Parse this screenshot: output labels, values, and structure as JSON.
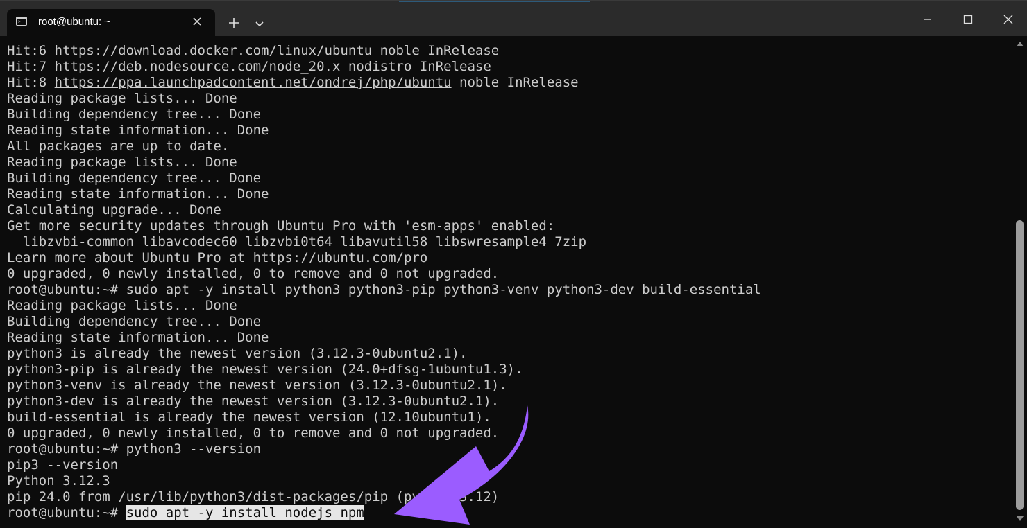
{
  "window": {
    "tab_title": "root@ubuntu: ~",
    "tab_icon": "terminal-icon",
    "controls": [
      "close-icon",
      "plus-icon",
      "chevron-down-icon",
      "minimize-icon",
      "maximize-icon",
      "close-icon"
    ]
  },
  "terminal": {
    "lines": [
      "Hit:6 https://download.docker.com/linux/ubuntu noble InRelease",
      "Hit:7 https://deb.nodesource.com/node_20.x nodistro InRelease",
      "Reading package lists... Done",
      "Building dependency tree... Done",
      "Reading state information... Done",
      "All packages are up to date.",
      "Reading package lists... Done",
      "Building dependency tree... Done",
      "Reading state information... Done",
      "Calculating upgrade... Done",
      "Get more security updates through Ubuntu Pro with 'esm-apps' enabled:",
      "  libzvbi-common libavcodec60 libzvbi0t64 libavutil58 libswresample4 7zip",
      "Learn more about Ubuntu Pro at https://ubuntu.com/pro",
      "0 upgraded, 0 newly installed, 0 to remove and 0 not upgraded.",
      "root@ubuntu:~# sudo apt -y install python3 python3-pip python3-venv python3-dev build-essential",
      "Reading package lists... Done",
      "Building dependency tree... Done",
      "Reading state information... Done",
      "python3 is already the newest version (3.12.3-0ubuntu2.1).",
      "python3-pip is already the newest version (24.0+dfsg-1ubuntu1.3).",
      "python3-venv is already the newest version (3.12.3-0ubuntu2.1).",
      "python3-dev is already the newest version (3.12.3-0ubuntu2.1).",
      "build-essential is already the newest version (12.10ubuntu1).",
      "0 upgraded, 0 newly installed, 0 to remove and 0 not upgraded.",
      "root@ubuntu:~# python3 --version",
      "pip3 --version",
      "Python 3.12.3",
      "pip 24.0 from /usr/lib/python3/dist-packages/pip (python 3.12)"
    ],
    "hit8": {
      "prefix": "Hit:8 ",
      "url": "https://ppa.launchpadcontent.net/ondrej/php/ubuntu",
      "suffix": " noble InRelease"
    },
    "prompt": "root@ubuntu:~# ",
    "current_command": "sudo apt -y install nodejs npm"
  },
  "colors": {
    "background": "#0c0c0c",
    "text": "#cccccc",
    "annotation_arrow": "#9b5cff"
  }
}
